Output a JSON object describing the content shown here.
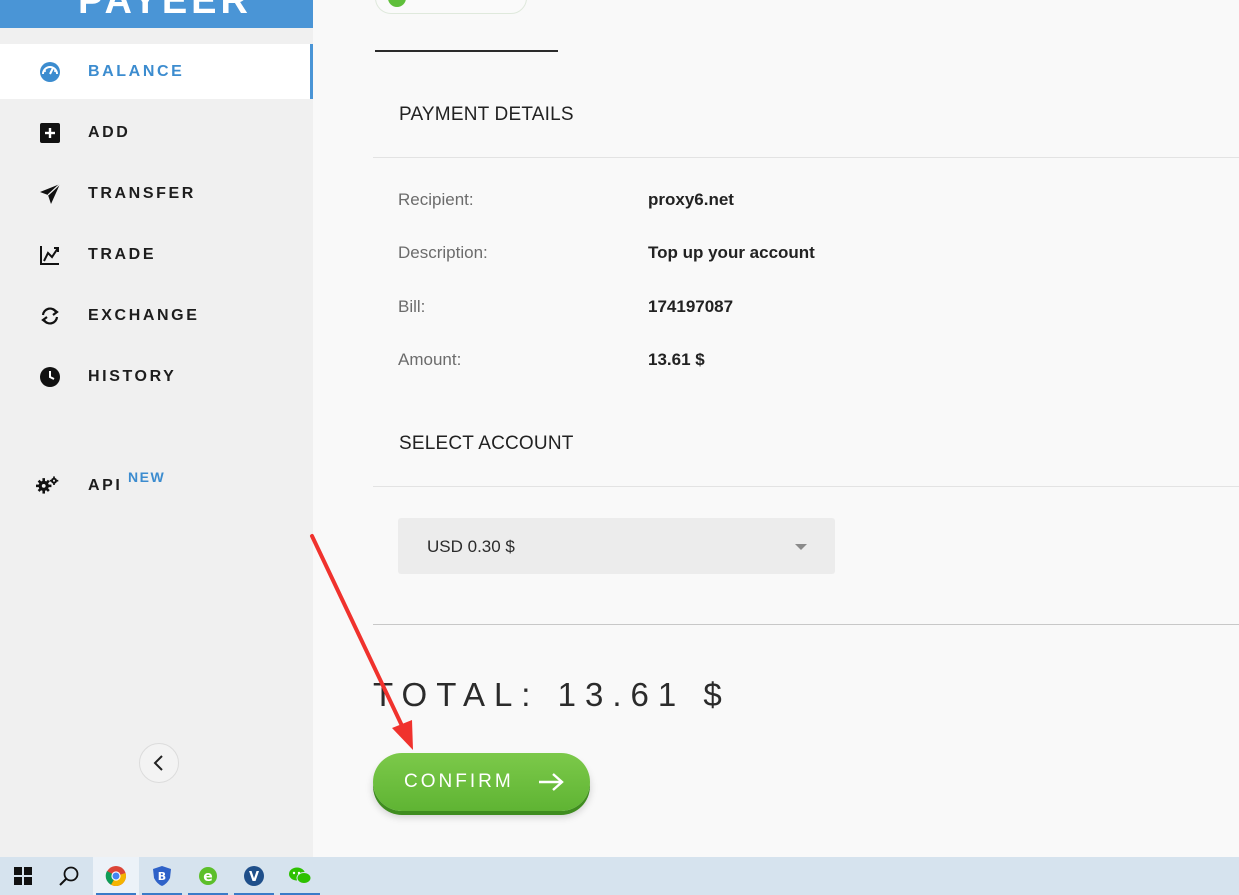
{
  "brand": {
    "logo_text": "PAYEER"
  },
  "sidebar": {
    "items": [
      {
        "label": "BALANCE",
        "icon": "dashboard-gauge-icon",
        "active": true
      },
      {
        "label": "ADD",
        "icon": "plus-square-icon"
      },
      {
        "label": "TRANSFER",
        "icon": "paper-plane-icon"
      },
      {
        "label": "TRADE",
        "icon": "chart-trend-icon"
      },
      {
        "label": "EXCHANGE",
        "icon": "refresh-arrows-icon"
      },
      {
        "label": "HISTORY",
        "icon": "clock-icon"
      },
      {
        "label": "API",
        "icon": "gears-icon",
        "badge": "NEW"
      }
    ],
    "collapse_icon": "chevron-left-icon"
  },
  "payment": {
    "section_title": "PAYMENT DETAILS",
    "rows": [
      {
        "label": "Recipient:",
        "value": "proxy6.net"
      },
      {
        "label": "Description:",
        "value": "Top up your account"
      },
      {
        "label": "Bill:",
        "value": "174197087"
      },
      {
        "label": "Amount:",
        "value": "13.61 $"
      }
    ]
  },
  "account": {
    "section_title": "SELECT ACCOUNT",
    "selected": "USD 0.30 $"
  },
  "total": {
    "text": "TOTAL: 13.61 $"
  },
  "confirm": {
    "label": "CONFIRM",
    "icon": "arrow-right-icon"
  },
  "colors": {
    "accent_blue": "#4a95d6",
    "confirm_green": "#6cbf3e",
    "annotation_red": "#f0322d"
  },
  "taskbar": {
    "items": [
      "windows-start-icon",
      "search-icon",
      "chrome-icon",
      "shield-app-icon",
      "ie-browser-icon",
      "v-app-icon",
      "wechat-icon"
    ]
  }
}
